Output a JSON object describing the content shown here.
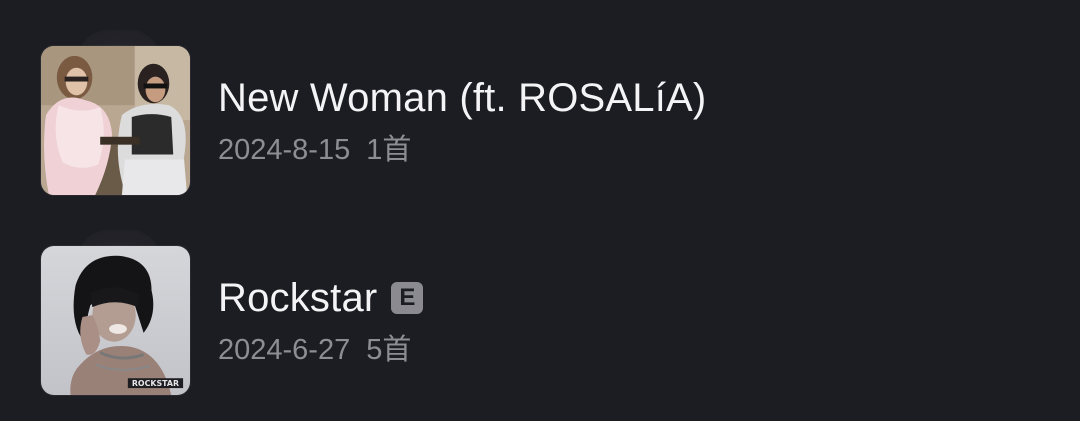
{
  "albums": [
    {
      "title": "New Woman (ft. ROSALíA)",
      "date": "2024-8-15",
      "count": "1首",
      "explicit": false,
      "cover_icon": "album-cover-two-women"
    },
    {
      "title": "Rockstar",
      "date": "2024-6-27",
      "count": "5首",
      "explicit": true,
      "explicit_label": "E",
      "cover_icon": "album-cover-rockstar",
      "cover_text": "ROCKSTAR"
    }
  ],
  "colors": {
    "background": "#1c1c23",
    "title": "#f4f4f6",
    "meta": "#8d8d94",
    "explicit_badge": "#8a8a90"
  }
}
